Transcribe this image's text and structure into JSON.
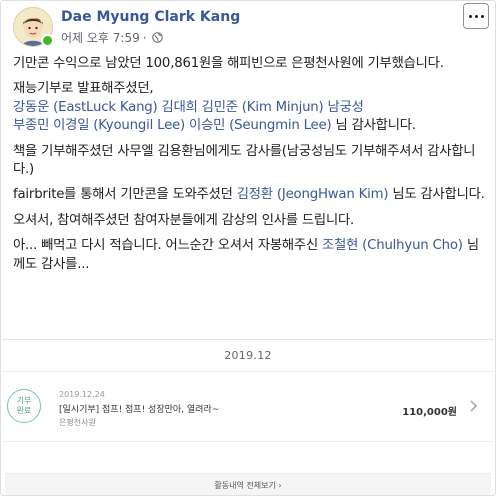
{
  "post": {
    "author": "Dae Myung Clark Kang",
    "timestamp": "어제 오후 7:59",
    "separator": "·",
    "privacy_icon": "globe-icon",
    "more_icon": "more-options-icon"
  },
  "body": {
    "p1": "기만콘 수익으로 남았던 100,861원을 해피빈으로 은평천사원에 기부했습니다.",
    "p2_line1": "재능기부로 발표해주셨던,",
    "p2_names1": "강동운 (EastLuck Kang) 김대희 김민준 (Kim Minjun) 남궁성",
    "p2_names2": "부종민 이경일 (Kyoungil Lee) 이승민 (Seungmin Lee)",
    "p2_suffix": " 님 감사합니다.",
    "p3": "책을 기부해주셨던 사무엘 김용환님에게도 감사를(남궁성님도 기부해주셔서 감사합니다.)",
    "p4_pre": "fairbrite를 통해서 기만콘을 도와주셨던 ",
    "p4_link": "김정환 (JeongHwan Kim)",
    "p4_post": " 님도 감사합니다.",
    "p5": "오셔서, 참여해주셨던 참여자분들에게 감상의 인사를 드립니다.",
    "p6_pre": "아... 빼먹고 다시 적습니다. 어느순간 오셔서 자봉해주신 ",
    "p6_link": "조철현 (Chulhyun Cho)",
    "p6_post": " 님께도 감사를..."
  },
  "donation": {
    "month": "2019.12",
    "badge_line1": "기부",
    "badge_line2": "완료",
    "date": "2019.12.24",
    "title": "[일시기부] 점프! 점프! 성장만아, 열려라~",
    "organization": "은평천사원",
    "amount": "110,000원",
    "history_label": "활동내역 전체보기 ›"
  },
  "colors": {
    "link": "#385898",
    "online": "#42b72a",
    "badge": "#4aa77c"
  }
}
